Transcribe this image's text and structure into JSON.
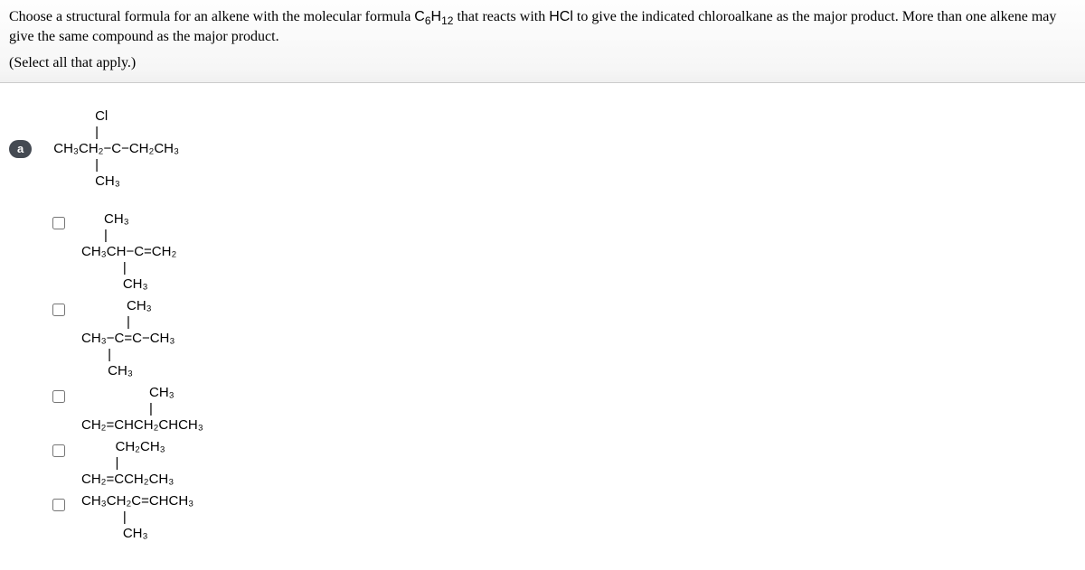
{
  "question": {
    "line1_pre": "Choose a structural formula for an alkene with the molecular formula ",
    "formula_C": "C",
    "formula_sub1": "6",
    "formula_H": "H",
    "formula_sub2": "12",
    "line1_mid": " that reacts with ",
    "reagent": "HCl",
    "line1_post": " to give the indicated chloroalkane as the major product. More than one alkene may give the same compound as the major product.",
    "select_all": "(Select all that apply.)"
  },
  "badge": "a",
  "product": {
    "line1": "           Cl",
    "line2": "           |",
    "line3": "CH₃CH₂−C−CH₂CH₃",
    "line4": "           |",
    "line5": "           CH₃"
  },
  "options": [
    {
      "lines": [
        "      CH₃",
        "      |",
        "CH₃CH−C=CH₂",
        "           |",
        "           CH₃"
      ]
    },
    {
      "lines": [
        "            CH₃",
        "            |",
        "CH₃−C=C−CH₃",
        "       |",
        "       CH₃"
      ]
    },
    {
      "lines": [
        "                  CH₃",
        "                  |",
        "CH₂=CHCH₂CHCH₃"
      ]
    },
    {
      "lines": [
        "         CH₂CH₃",
        "         |",
        "CH₂=CCH₂CH₃"
      ]
    },
    {
      "lines": [
        "CH₃CH₂C=CHCH₃",
        "           |",
        "           CH₃"
      ]
    }
  ]
}
